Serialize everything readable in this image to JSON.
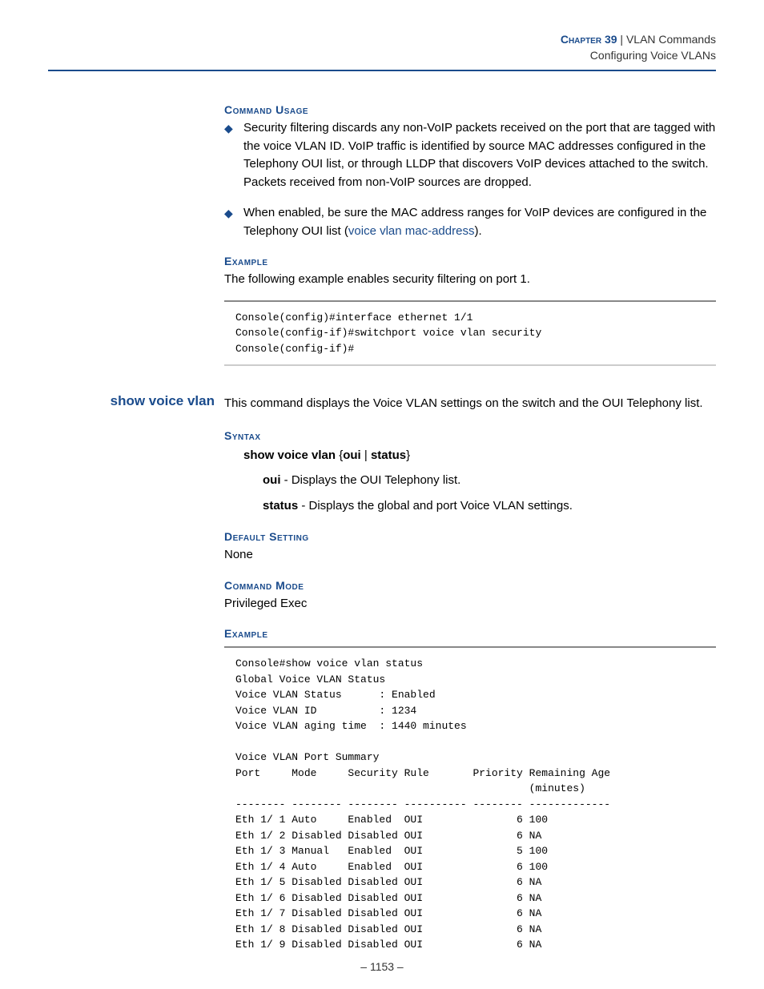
{
  "header": {
    "chapter": "Chapter 39",
    "divider": "  |  ",
    "topic": "VLAN Commands",
    "subtopic": "Configuring Voice VLANs"
  },
  "sec1": {
    "head": "Command Usage",
    "bullet1_a": "Security filtering discards any non-VoIP packets received on the port that are tagged with the voice VLAN ID. VoIP traffic is identified by source MAC addresses configured in the Telephony OUI list, or through LLDP that discovers VoIP devices attached to the switch. Packets received from non-VoIP sources are dropped.",
    "bullet2_a": "When enabled, be sure the MAC address ranges for VoIP devices are configured in the Telephony OUI list (",
    "bullet2_link": "voice vlan mac-address",
    "bullet2_b": ")."
  },
  "sec2": {
    "head": "Example",
    "intro": "The following example enables security filtering on port 1.",
    "code": "Console(config)#interface ethernet 1/1\nConsole(config-if)#switchport voice vlan security\nConsole(config-if)#"
  },
  "cmd": {
    "name": "show voice vlan",
    "desc": "This command displays the Voice VLAN settings on the switch and the OUI Telephony list."
  },
  "syntax": {
    "head": "Syntax",
    "cmd_bold": "show voice vlan",
    "brace_open": " {",
    "opt1": "oui",
    "pipe": " | ",
    "opt2": "status",
    "brace_close": "}",
    "p1_b": "oui",
    "p1_t": " - Displays the OUI Telephony list.",
    "p2_b": "status",
    "p2_t": " - Displays the global and port Voice VLAN settings."
  },
  "defset": {
    "head": "Default Setting",
    "val": "None"
  },
  "cmdmode": {
    "head": "Command Mode",
    "val": "Privileged Exec"
  },
  "ex2": {
    "head": "Example",
    "code": "Console#show voice vlan status\nGlobal Voice VLAN Status\nVoice VLAN Status      : Enabled\nVoice VLAN ID          : 1234\nVoice VLAN aging time  : 1440 minutes\n\nVoice VLAN Port Summary\nPort     Mode     Security Rule       Priority Remaining Age\n                                               (minutes)\n-------- -------- -------- ---------- -------- -------------\nEth 1/ 1 Auto     Enabled  OUI               6 100\nEth 1/ 2 Disabled Disabled OUI               6 NA\nEth 1/ 3 Manual   Enabled  OUI               5 100\nEth 1/ 4 Auto     Enabled  OUI               6 100\nEth 1/ 5 Disabled Disabled OUI               6 NA\nEth 1/ 6 Disabled Disabled OUI               6 NA\nEth 1/ 7 Disabled Disabled OUI               6 NA\nEth 1/ 8 Disabled Disabled OUI               6 NA\nEth 1/ 9 Disabled Disabled OUI               6 NA"
  },
  "footer": {
    "page": "– 1153 –"
  }
}
